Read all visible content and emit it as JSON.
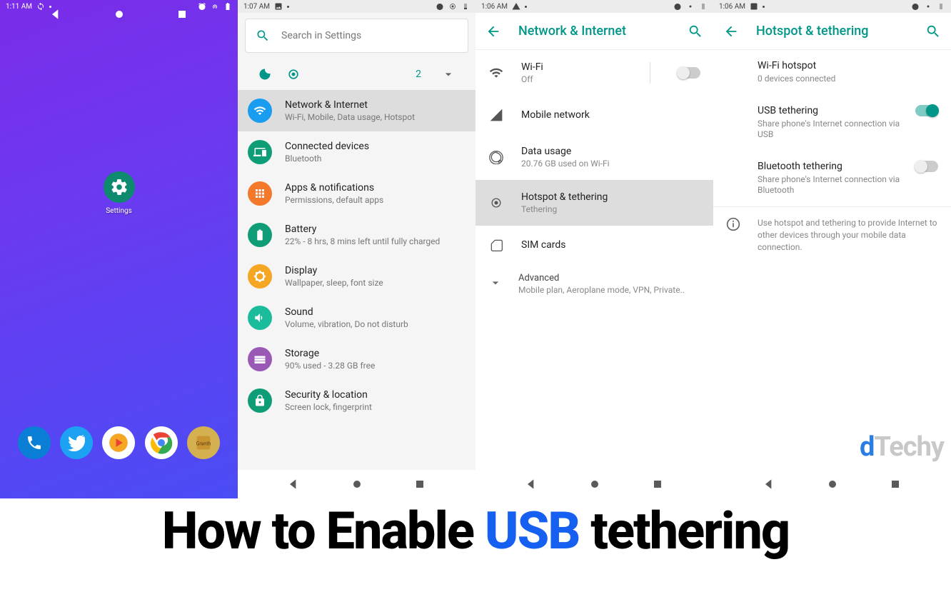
{
  "phone1": {
    "status_time": "1:11 AM",
    "app_label": "Settings"
  },
  "phone2": {
    "status_time": "1:07 AM",
    "search_placeholder": "Search in Settings",
    "qs_count": "2",
    "items": [
      {
        "title": "Network & Internet",
        "sub": "Wi-Fi, Mobile, Data usage, Hotspot",
        "color": "#1a9cf0"
      },
      {
        "title": "Connected devices",
        "sub": "Bluetooth",
        "color": "#0e9d76"
      },
      {
        "title": "Apps & notifications",
        "sub": "Permissions, default apps",
        "color": "#f5792b"
      },
      {
        "title": "Battery",
        "sub": "22% - 8 hrs, 8 mins left until fully charged",
        "color": "#0e9d76"
      },
      {
        "title": "Display",
        "sub": "Wallpaper, sleep, font size",
        "color": "#f5a623"
      },
      {
        "title": "Sound",
        "sub": "Volume, vibration, Do not disturb",
        "color": "#1abc9c"
      },
      {
        "title": "Storage",
        "sub": "90% used - 3.28 GB free",
        "color": "#9b59b6"
      },
      {
        "title": "Security & location",
        "sub": "Screen lock, fingerprint",
        "color": "#0e9d76"
      }
    ]
  },
  "phone3": {
    "status_time": "1:06 AM",
    "header": "Network & Internet",
    "items": [
      {
        "title": "Wi-Fi",
        "sub": "Off"
      },
      {
        "title": "Mobile network",
        "sub": ""
      },
      {
        "title": "Data usage",
        "sub": "20.76 GB used on Wi-Fi"
      },
      {
        "title": "Hotspot & tethering",
        "sub": "Tethering"
      },
      {
        "title": "SIM cards",
        "sub": ""
      }
    ],
    "advanced_title": "Advanced",
    "advanced_sub": "Mobile plan, Aeroplane mode, VPN, Private.."
  },
  "phone4": {
    "status_time": "1:06 AM",
    "header": "Hotspot & tethering",
    "items": [
      {
        "title": "Wi-Fi hotspot",
        "sub": "0 devices connected"
      },
      {
        "title": "USB tethering",
        "sub": "Share phone's Internet connection via USB"
      },
      {
        "title": "Bluetooth tethering",
        "sub": "Share phone's Internet connection via Bluetooth"
      }
    ],
    "info": "Use hotspot and tethering to provide Internet to other devices through your mobile data connection.",
    "watermark_d": "d",
    "watermark_techy": "Techy"
  },
  "title": {
    "part1": "How to Enable ",
    "usb": "USB",
    "part2": " tethering"
  }
}
